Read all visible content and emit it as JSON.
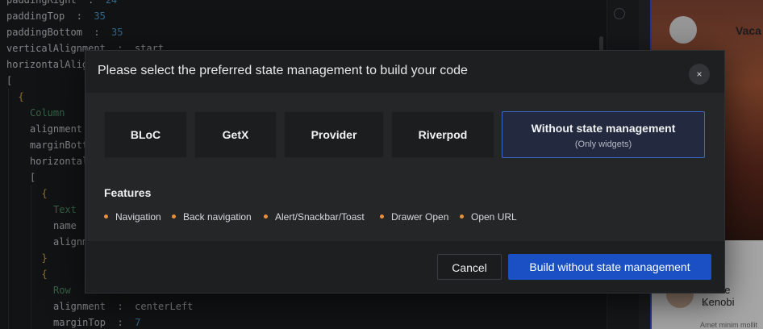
{
  "editor": {
    "lines": [
      {
        "indent": 0,
        "parts": [
          {
            "t": "paddingRight  :  ",
            "c": "k"
          },
          {
            "t": "24",
            "c": "num"
          }
        ]
      },
      {
        "indent": 0,
        "parts": [
          {
            "t": "paddingTop  :  ",
            "c": "k"
          },
          {
            "t": "35",
            "c": "num"
          }
        ]
      },
      {
        "indent": 0,
        "parts": [
          {
            "t": "paddingBottom  :  ",
            "c": "k"
          },
          {
            "t": "35",
            "c": "num"
          }
        ]
      },
      {
        "indent": 0,
        "parts": [
          {
            "t": "verticalAlignment  :  start",
            "c": "k"
          }
        ]
      },
      {
        "indent": 0,
        "parts": [
          {
            "t": "horizontalAlignment",
            "c": "k"
          }
        ]
      },
      {
        "indent": 0,
        "parts": [
          {
            "t": "[",
            "c": "k"
          }
        ]
      },
      {
        "indent": 1,
        "parts": [
          {
            "t": "{",
            "c": "brk"
          }
        ]
      },
      {
        "indent": 2,
        "parts": [
          {
            "t": "Column",
            "c": "w"
          }
        ]
      },
      {
        "indent": 2,
        "parts": [
          {
            "t": "alignment",
            "c": "k"
          }
        ]
      },
      {
        "indent": 2,
        "parts": [
          {
            "t": "marginBottom",
            "c": "k"
          }
        ]
      },
      {
        "indent": 2,
        "parts": [
          {
            "t": "horizontalAlignment",
            "c": "k"
          }
        ]
      },
      {
        "indent": 2,
        "parts": [
          {
            "t": "[",
            "c": "k"
          }
        ]
      },
      {
        "indent": 3,
        "parts": [
          {
            "t": "{",
            "c": "brk"
          }
        ]
      },
      {
        "indent": 4,
        "parts": [
          {
            "t": "Text",
            "c": "w"
          }
        ]
      },
      {
        "indent": 4,
        "parts": [
          {
            "t": "name",
            "c": "k"
          }
        ]
      },
      {
        "indent": 4,
        "parts": [
          {
            "t": "alignment",
            "c": "k"
          }
        ]
      },
      {
        "indent": 3,
        "parts": [
          {
            "t": "}",
            "c": "brk"
          }
        ]
      },
      {
        "indent": 3,
        "parts": [
          {
            "t": "{",
            "c": "brk"
          }
        ]
      },
      {
        "indent": 4,
        "parts": [
          {
            "t": "Row",
            "c": "w"
          }
        ]
      },
      {
        "indent": 4,
        "parts": [
          {
            "t": "alignment  :  centerLeft",
            "c": "k"
          }
        ]
      },
      {
        "indent": 4,
        "parts": [
          {
            "t": "marginTop  :  ",
            "c": "k"
          },
          {
            "t": "7",
            "c": "num"
          }
        ]
      }
    ]
  },
  "preview": {
    "title": "Vaca",
    "name": "Jhone Kenobi",
    "lorem": "Amet minim mollit"
  },
  "modal": {
    "title": "Please select the preferred state management to build your code",
    "close_label": "×",
    "options": [
      {
        "label": "BLoC"
      },
      {
        "label": "GetX"
      },
      {
        "label": "Provider"
      },
      {
        "label": "Riverpod"
      },
      {
        "label": "Without state management",
        "sub": "(Only widgets)",
        "selected": true
      }
    ],
    "features_title": "Features",
    "features": [
      "Navigation",
      "Back navigation",
      "Alert/Snackbar/Toast",
      "Drawer Open",
      "Open URL"
    ],
    "cancel_label": "Cancel",
    "build_label": "Build without state management"
  },
  "colors": {
    "accent": "#1b4fc4",
    "selected_border": "#3b67c7",
    "feature_dot": "#e8913a"
  }
}
